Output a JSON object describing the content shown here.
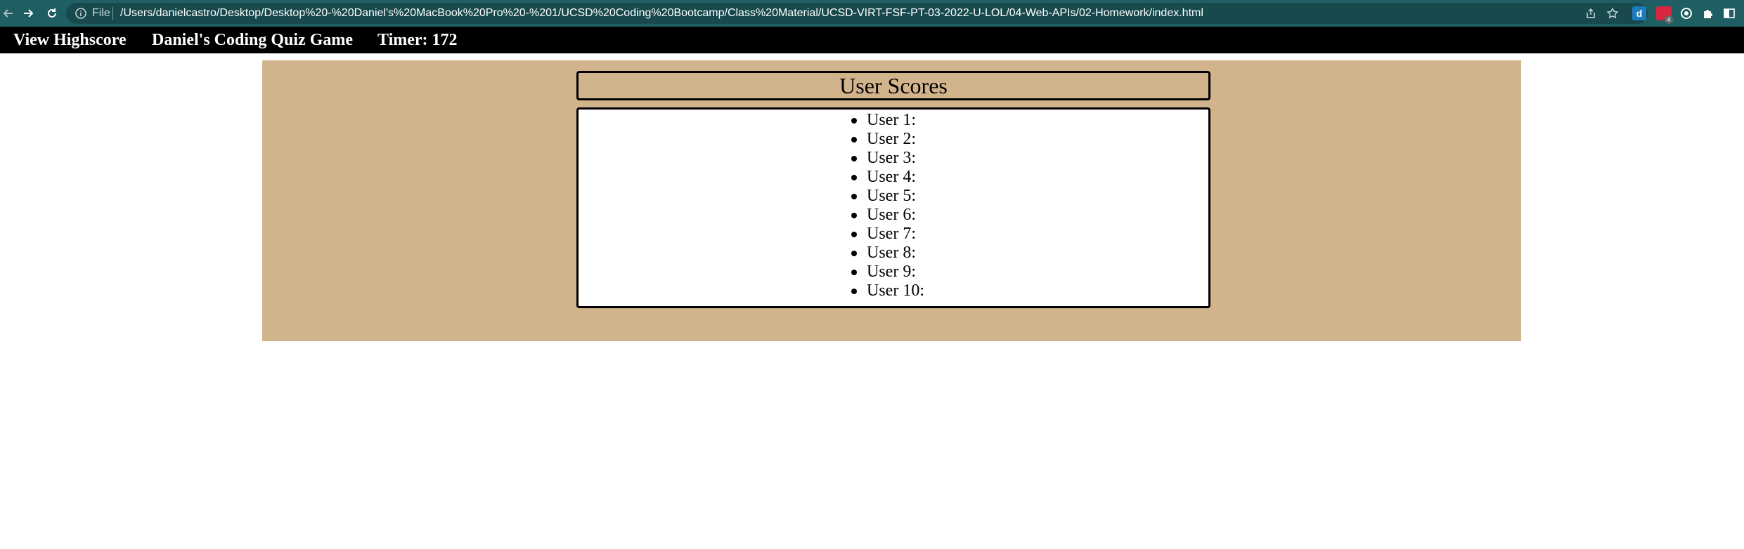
{
  "browser": {
    "file_label": "File",
    "url": "/Users/danielcastro/Desktop/Desktop%20-%20Daniel's%20MacBook%20Pro%20-%201/UCSD%20Coding%20Bootcamp/Class%20Material/UCSD-VIRT-FSF-PT-03-2022-U-LOL/04-Web-APIs/02-Homework/index.html",
    "extension_d_label": "d",
    "extension_badge": "4"
  },
  "header": {
    "view_highscore": "View Highscore",
    "game_title": "Daniel's Coding Quiz Game",
    "timer": "Timer: 172"
  },
  "scores": {
    "title": "User Scores",
    "items": [
      "User 1:",
      "User 2:",
      "User 3:",
      "User 4:",
      "User 5:",
      "User 6:",
      "User 7:",
      "User 8:",
      "User 9:",
      "User 10:"
    ]
  },
  "colors": {
    "chrome_bg": "#1f5f64",
    "header_bg": "#000000",
    "panel_bg": "#d2b48c",
    "list_bg": "#ffffff"
  }
}
